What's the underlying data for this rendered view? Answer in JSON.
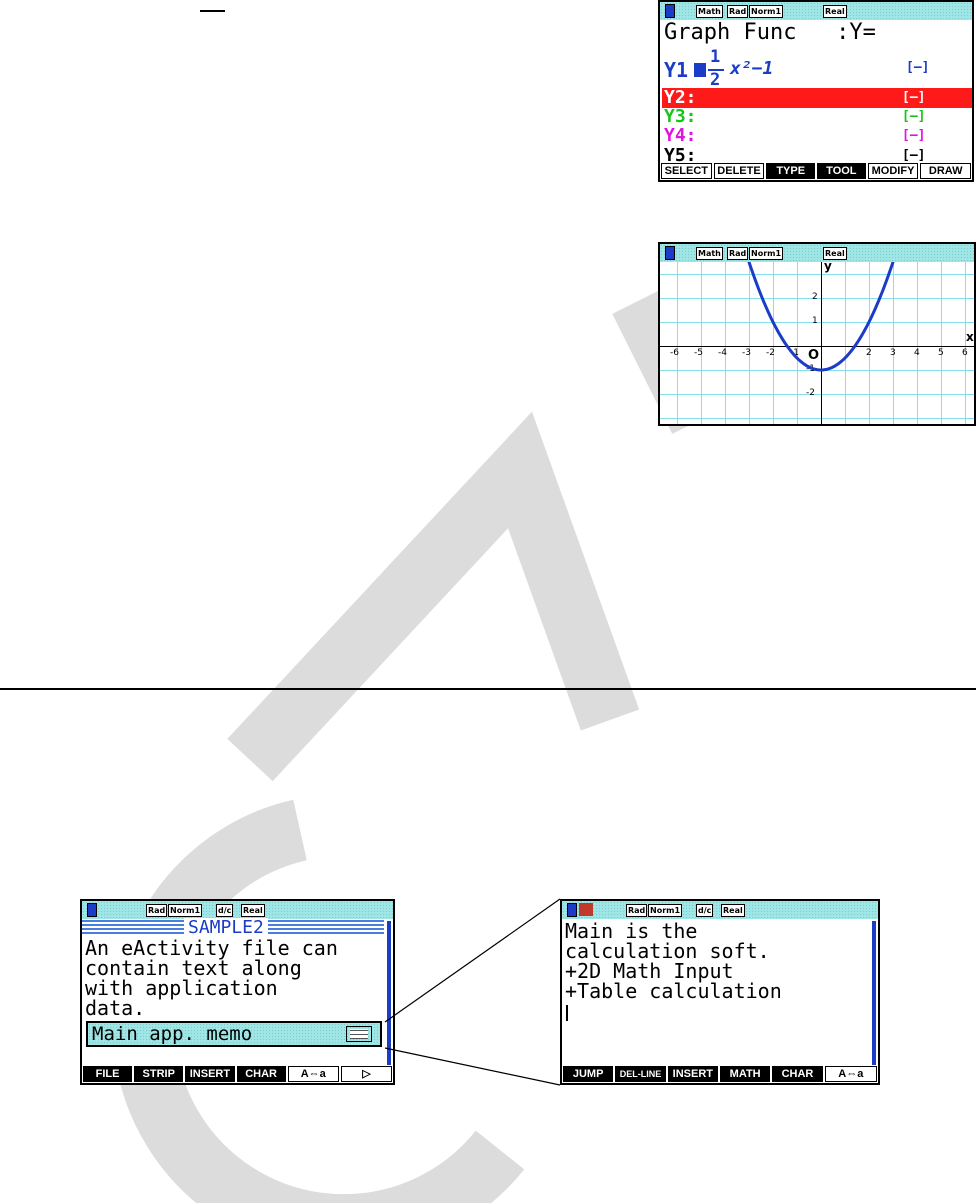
{
  "screen1": {
    "status": [
      "Math",
      "Rad",
      "Norm1",
      "Real"
    ],
    "title": "Graph Func   :Y=",
    "y1_label": "Y1",
    "y1_num": "1",
    "y1_den": "2",
    "y1_rest": "x²−1",
    "rows": [
      {
        "label": "Y2:",
        "style": "[—]"
      },
      {
        "label": "Y3:",
        "style": "[—]"
      },
      {
        "label": "Y4:",
        "style": "[—]"
      },
      {
        "label": "Y5:",
        "style": "[—]"
      }
    ],
    "y1_style": "[—]",
    "fkeys": [
      "SELECT",
      "DELETE",
      "TYPE",
      "TOOL",
      "MODIFY",
      "DRAW"
    ],
    "colors": {
      "y1": "#1a3cc6",
      "y2_bg": "#ff1a1a",
      "y3": "#18c41a",
      "y4": "#e014e0"
    }
  },
  "screen2": {
    "status": [
      "Math",
      "Rad",
      "Norm1",
      "Real"
    ],
    "x_label": "x",
    "y_label": "y",
    "origin": "O",
    "x_ticks": [
      "-6",
      "-5",
      "-4",
      "-3",
      "-2",
      "-1",
      "2",
      "3",
      "4",
      "5",
      "6"
    ],
    "y_ticks": [
      "2",
      "1",
      "-1",
      "-2"
    ],
    "curve_color": "#1a3cc6"
  },
  "screen3": {
    "status": [
      "Rad",
      "Norm1",
      "d/c",
      "Real"
    ],
    "title": "SAMPLE2",
    "lines": [
      "An eActivity file can",
      "contain text along",
      "with application",
      "data."
    ],
    "strip": "Main app. memo",
    "fkeys": [
      "FILE",
      "STRIP",
      "INSERT",
      "CHAR",
      "A⇔a",
      "▷"
    ]
  },
  "screen4": {
    "status": [
      "Rad",
      "Norm1",
      "d/c",
      "Real"
    ],
    "lines": [
      "Main is the",
      "calculation soft.",
      "+2D Math Input",
      "+Table calculation"
    ],
    "fkeys": [
      "JUMP",
      "DEL-LINE",
      "INSERT",
      "MATH",
      "CHAR",
      "A⇔a"
    ]
  }
}
